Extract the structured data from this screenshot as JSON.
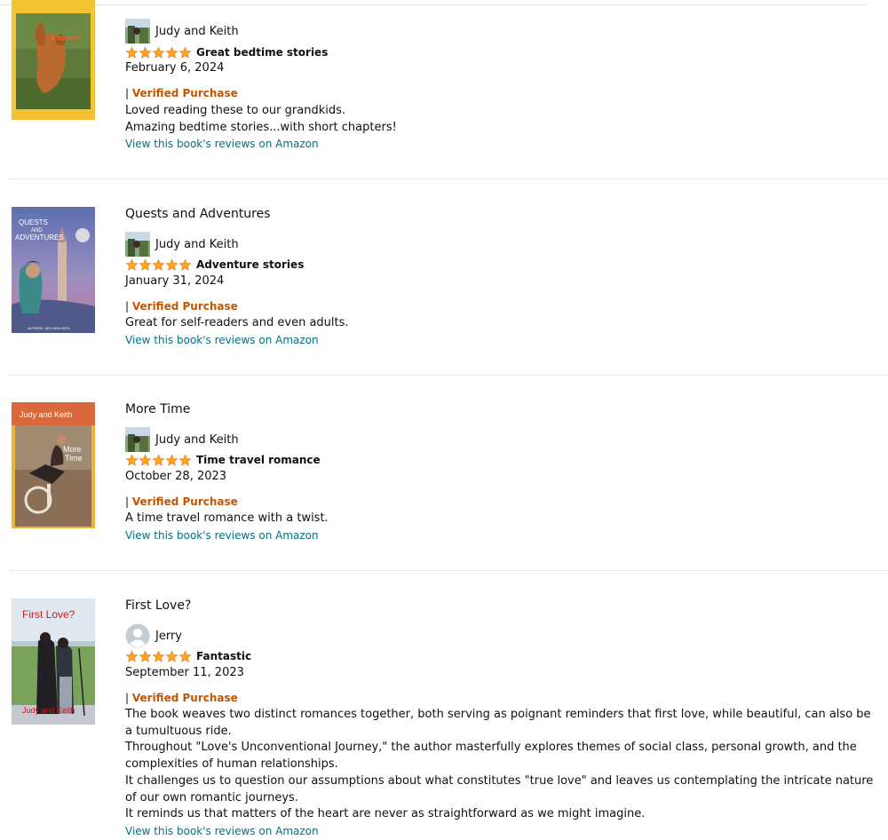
{
  "reviews": [
    {
      "title": "",
      "reviewer": "Judy and Keith",
      "stars": 5,
      "headline": "Great bedtime stories",
      "date": "February 6, 2024",
      "verified_bar": "|",
      "verified": "Verified Purchase",
      "body": [
        "Loved reading these to our grandkids.",
        "Amazing bedtime stories...with short chapters!"
      ],
      "link": "View this book's reviews on Amazon"
    },
    {
      "title": "Quests and Adventures",
      "reviewer": "Judy and Keith",
      "stars": 5,
      "headline": "Adventure stories",
      "date": "January 31, 2024",
      "verified_bar": "|",
      "verified": "Verified Purchase",
      "body": [
        "Great for self-readers and even adults."
      ],
      "link": "View this book's reviews on Amazon",
      "cover_text": {
        "title_line1": "QUESTS",
        "title_line2": "AND",
        "title_line3": "ADVENTURES",
        "authors": "AUTHORS: JUDY AND KEITH"
      }
    },
    {
      "title": "More Time",
      "reviewer": "Judy and Keith",
      "stars": 5,
      "headline": "Time travel romance",
      "date": "October 28, 2023",
      "verified_bar": "|",
      "verified": "Verified Purchase",
      "body": [
        "A time travel romance with a twist."
      ],
      "link": "View this book's reviews on Amazon",
      "cover_text": {
        "author": "Judy and Keith",
        "title_line1": "More",
        "title_line2": "Time"
      }
    },
    {
      "title": "First Love?",
      "reviewer": "Jerry",
      "stars": 5,
      "headline": "Fantastic",
      "date": "September 11, 2023",
      "verified_bar": "|",
      "verified": "Verified Purchase",
      "body": [
        "The book weaves two distinct romances together, both serving as poignant reminders that first love, while beautiful, can also be a tumultuous ride.",
        "Throughout \"Love's Unconventional Journey,\" the author masterfully explores themes of social class, personal growth, and the complexities of human relationships.",
        "It challenges us to question our assumptions about what constitutes \"true love\" and leaves us contemplating the intricate nature of our own romantic journeys.",
        "It reminds us that matters of the heart are never as straightforward as we might imagine."
      ],
      "link": "View this book's reviews on Amazon",
      "cover_text": {
        "title": "First Love?",
        "author": "Judy and Keith"
      }
    }
  ],
  "colors": {
    "link": "#007185",
    "verified": "#c45500",
    "star": "#ffa41c",
    "separator": "#e7e7e7"
  }
}
